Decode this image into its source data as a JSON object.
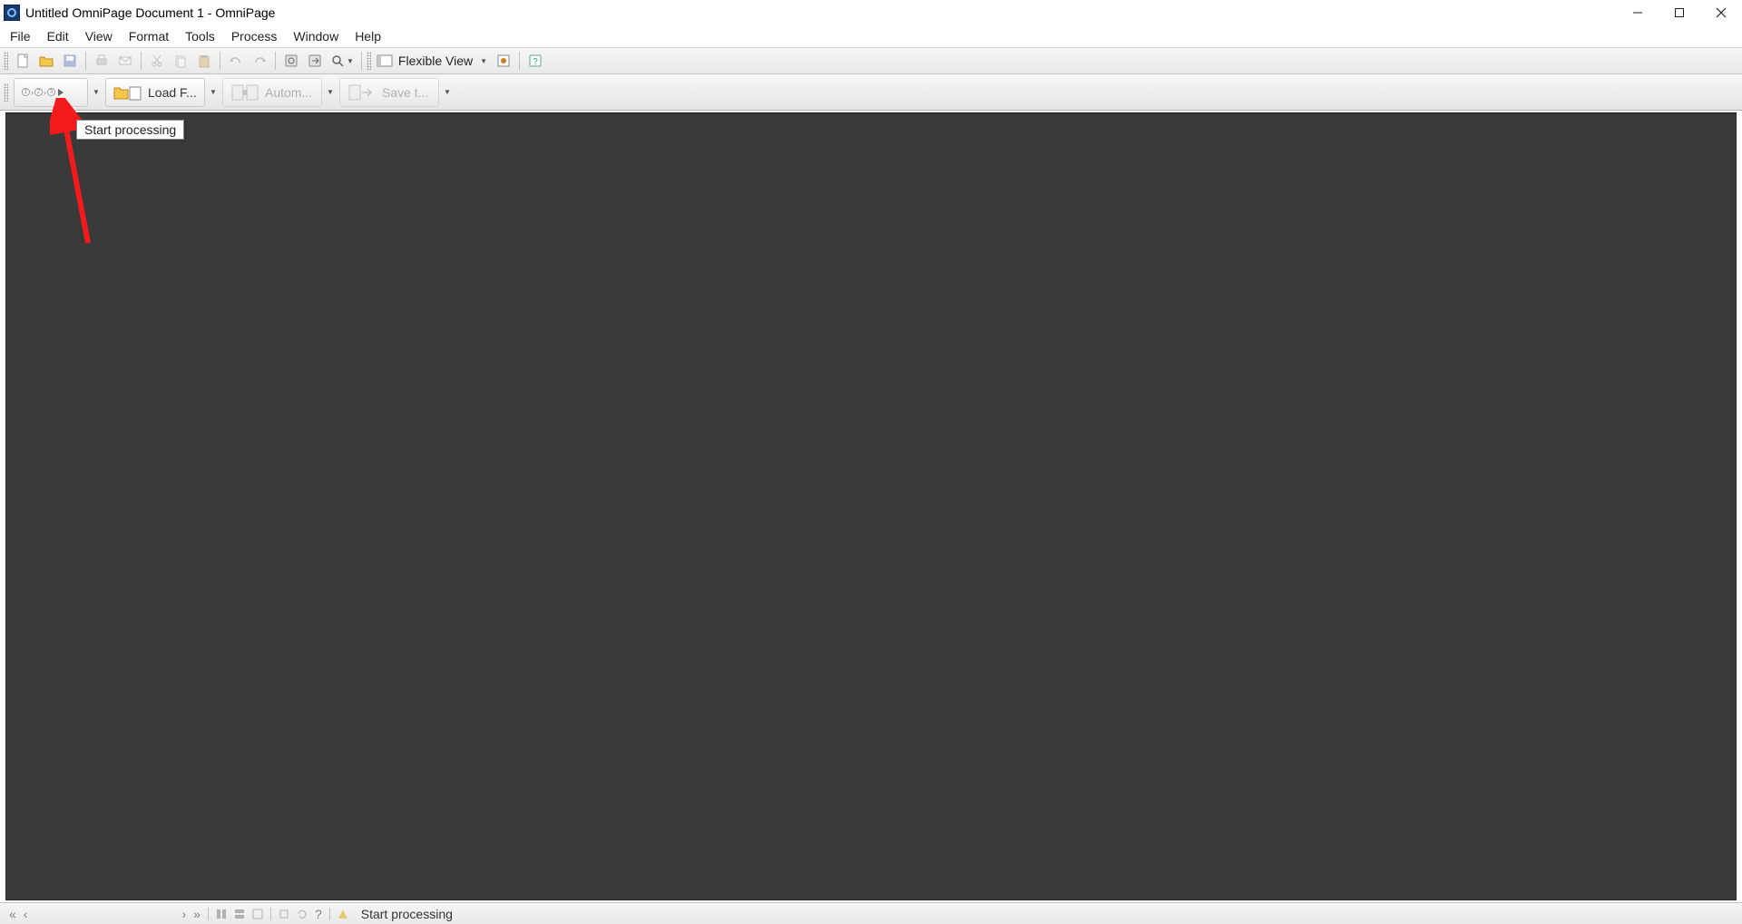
{
  "titlebar": {
    "title": "Untitled OmniPage Document 1 - OmniPage"
  },
  "menu": {
    "items": [
      "File",
      "Edit",
      "View",
      "Format",
      "Tools",
      "Process",
      "Window",
      "Help"
    ]
  },
  "toolbar_std": {
    "view_combo_label": "Flexible View"
  },
  "toolbar_big": {
    "load_label": "Load F...",
    "autom_label": "Autom...",
    "save_label": "Save t..."
  },
  "tooltip": {
    "text": "Start processing"
  },
  "statusbar": {
    "text": "Start processing"
  }
}
